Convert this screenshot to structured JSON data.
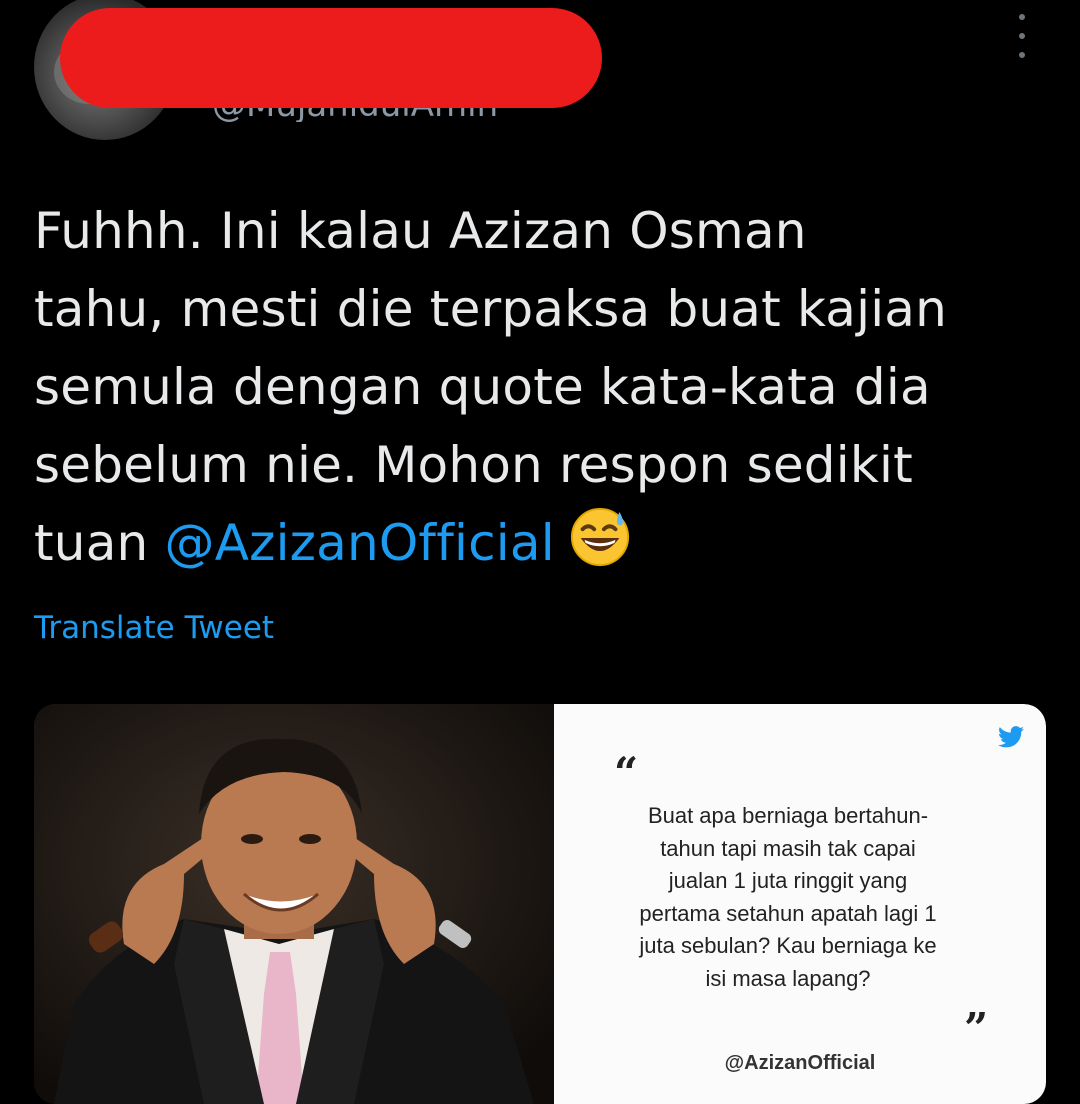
{
  "author": {
    "handle": "@MujahidulAmin"
  },
  "tweet": {
    "lines": [
      "Fuhhh. Ini kalau Azizan Osman",
      "tahu, mesti die terpaksa buat kajian",
      "semula dengan quote kata-kata dia",
      "sebelum nie. Mohon respon sedikit"
    ],
    "last_line_prefix": "tuan ",
    "mention": "@AzizanOfficial",
    "emoji": "grinning-face-with-sweat"
  },
  "translate_label": "Translate Tweet",
  "quote_card": {
    "open_quote": "“",
    "close_quote": "”",
    "lines": [
      "Buat apa berniaga bertahun-",
      "tahun tapi masih tak capai",
      "jualan 1 juta ringgit yang",
      "pertama setahun apatah lagi 1",
      "juta sebulan? Kau berniaga ke",
      "isi masa lapang?"
    ],
    "author": "@AzizanOfficial",
    "icon": "twitter-bird-icon"
  },
  "colors": {
    "background": "#000000",
    "text": "#e7e9ea",
    "link": "#1d9bf0",
    "redaction": "#ec1c1c",
    "card": "#fbfbfb"
  }
}
